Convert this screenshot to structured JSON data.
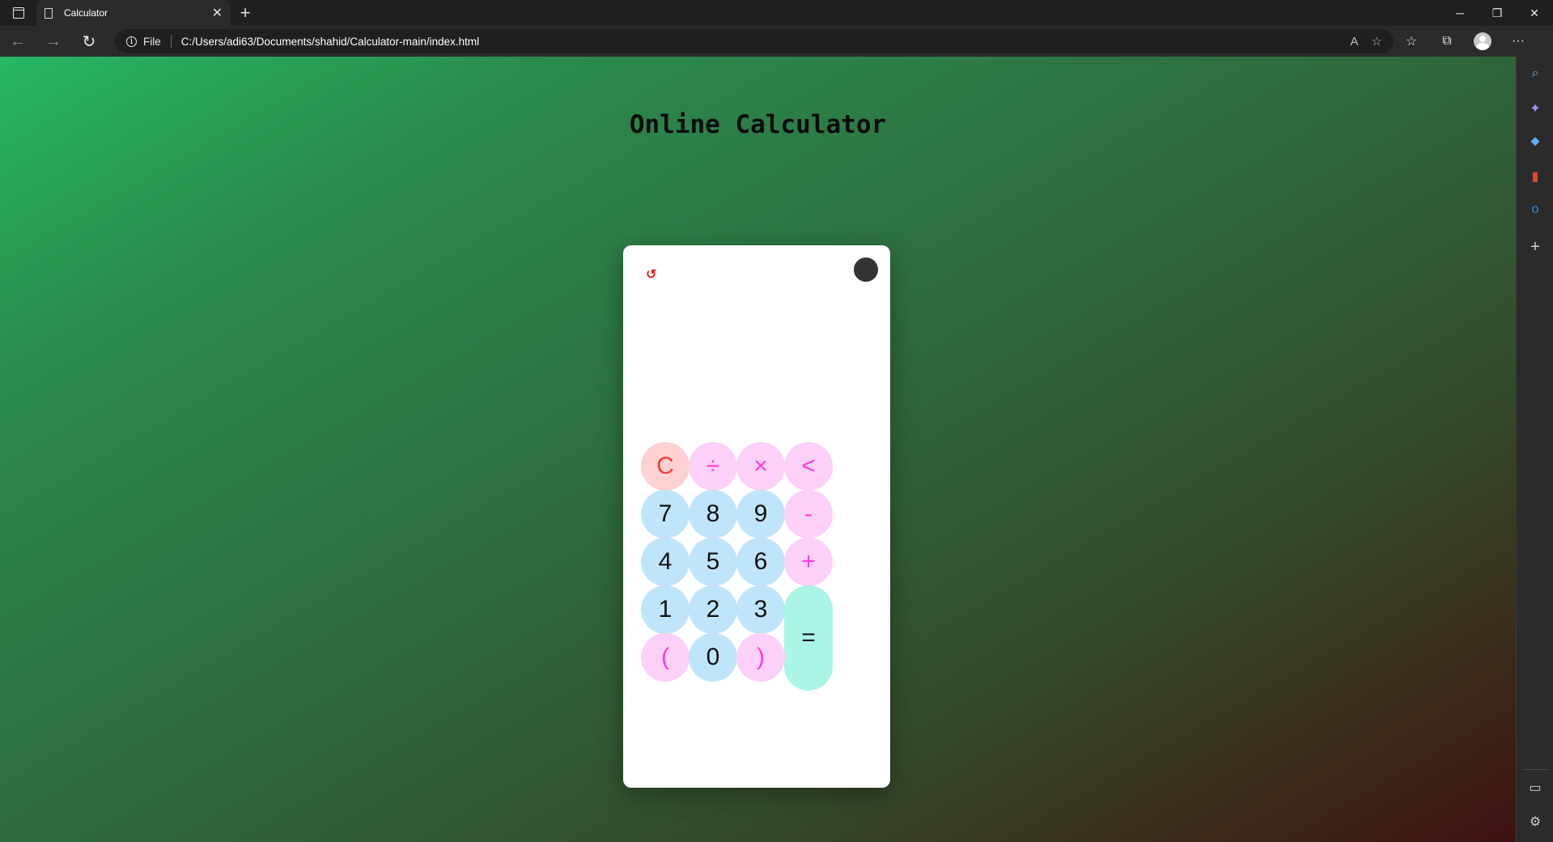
{
  "browser": {
    "tab": {
      "title": "Calculator",
      "icon": "document-icon"
    },
    "address": {
      "scheme_label": "File",
      "url": "C:/Users/adi63/Documents/shahid/Calculator-main/index.html"
    },
    "glyphs": {
      "tab_actions": "",
      "close": "✕",
      "new_tab": "+",
      "minimize": "─",
      "restore": "❐",
      "window_close": "✕",
      "back": "←",
      "forward": "→",
      "refresh": "↻",
      "info": "i",
      "read_aloud": "A",
      "add_favorite": "☆",
      "favorites": "☆",
      "collections": "⧉",
      "more": "···"
    },
    "sidebar": {
      "search": "⌕",
      "copilot": "✦",
      "shopping": "⬥",
      "office": "▮",
      "outlook": "o",
      "add": "+",
      "hide": "▭",
      "settings": "⚙"
    }
  },
  "page": {
    "title": "Online Calculator",
    "calculator": {
      "history_icon": "↺",
      "display_value": "",
      "keys": {
        "clear": "C",
        "divide": "÷",
        "multiply": "×",
        "backspace": "<",
        "seven": "7",
        "eight": "8",
        "nine": "9",
        "minus": "-",
        "four": "4",
        "five": "5",
        "six": "6",
        "plus": "+",
        "one": "1",
        "two": "2",
        "three": "3",
        "equals": "=",
        "open_paren": "(",
        "zero": "0",
        "close_paren": ")"
      }
    }
  },
  "colors": {
    "number_key": "#bfe5fb",
    "operator_key": "#fdd0f7",
    "operator_text": "#ff3cd9",
    "clear_key": "#fdd1d1",
    "clear_text": "#f33c3c",
    "equals_key": "#aaf5e5",
    "theme_toggle": "#333333",
    "history_icon": "#e0241b"
  }
}
